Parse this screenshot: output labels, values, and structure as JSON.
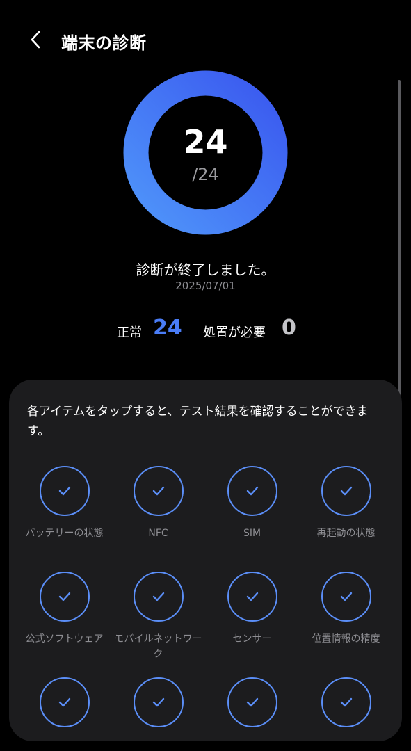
{
  "header": {
    "title": "端末の診断"
  },
  "summary": {
    "score": "24",
    "total": "/24",
    "status_text": "診断が終了しました。",
    "date": "2025/07/01",
    "normal_label": "正常",
    "normal_count": "24",
    "action_label": "処置が必要",
    "action_count": "0",
    "progress_fraction": 1.0
  },
  "card": {
    "description": "各アイテムをタップすると、テスト結果を確認することができます。"
  },
  "items": [
    {
      "label": "バッテリーの状態",
      "status": "ok"
    },
    {
      "label": "NFC",
      "status": "ok"
    },
    {
      "label": "SIM",
      "status": "ok"
    },
    {
      "label": "再起動の状態",
      "status": "ok"
    },
    {
      "label": "公式ソフトウェア",
      "status": "ok"
    },
    {
      "label": "モバイルネットワーク",
      "status": "ok"
    },
    {
      "label": "センサー",
      "status": "ok"
    },
    {
      "label": "位置情報の精度",
      "status": "ok"
    },
    {
      "label": "",
      "status": "ok"
    },
    {
      "label": "",
      "status": "ok"
    },
    {
      "label": "",
      "status": "ok"
    },
    {
      "label": "",
      "status": "ok"
    }
  ],
  "colors": {
    "ring_start": "#4d8ef8",
    "ring_end": "#3c5ef0",
    "accent": "#4a7df7",
    "check": "#5b8ef7"
  },
  "icons": {
    "back": "chevron-left-icon",
    "item": "check-icon"
  }
}
